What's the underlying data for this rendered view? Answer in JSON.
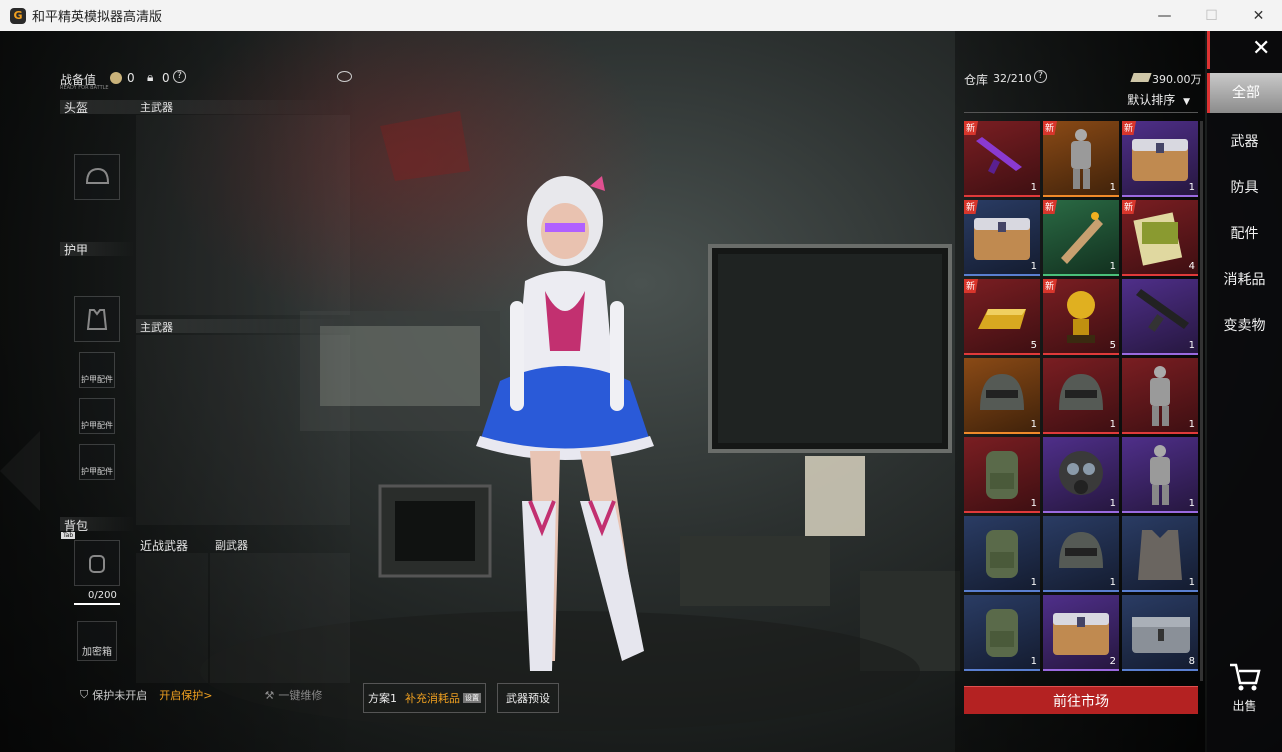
{
  "window": {
    "title": "和平精英模拟器高清版",
    "minimize": "—",
    "maximize": "☐",
    "close": "✕"
  },
  "left": {
    "combat_label": "战备值",
    "combat_value": "0",
    "lock_value": "0",
    "help": "?",
    "sub_label": "READY FOR BATTLE",
    "slots": {
      "helmet": "头盔",
      "primary1": "主武器",
      "armor": "护甲",
      "primary2": "主武器",
      "armor_attach": "护甲配件",
      "backpack": "背包",
      "melee": "近战武器",
      "secondary": "副武器",
      "bag_capacity": "0/200",
      "safe_box": "加密箱",
      "bag_key": "Tab"
    }
  },
  "bottom": {
    "protect_status": "保护未开启",
    "protect_action": "开启保护>",
    "repair": "一键维修",
    "plan": "方案1",
    "refill": "补充消耗品",
    "refill_tag": "设置",
    "preset": "武器预设"
  },
  "warehouse": {
    "label": "仓库",
    "count": "32/210",
    "help": "?",
    "money": "390.00万",
    "sort": "默认排序",
    "new_tag": "新",
    "market_button": "前往市场"
  },
  "items": [
    {
      "name": "紫色步枪",
      "rarity": "red",
      "qty": "1",
      "new": true,
      "icon": "rifle-icon"
    },
    {
      "name": "套装",
      "rarity": "orange",
      "qty": "1",
      "new": true,
      "icon": "suit-icon"
    },
    {
      "name": "补给箱",
      "rarity": "purple",
      "qty": "1",
      "new": true,
      "icon": "crate-icon"
    },
    {
      "name": "银色箱子",
      "rarity": "blue",
      "qty": "1",
      "new": true,
      "icon": "crate-icon"
    },
    {
      "name": "卷轴",
      "rarity": "green",
      "qty": "1",
      "new": true,
      "icon": "scroll-icon"
    },
    {
      "name": "书籍",
      "rarity": "red",
      "qty": "4",
      "new": true,
      "icon": "book-icon"
    },
    {
      "name": "金条",
      "rarity": "red",
      "qty": "5",
      "new": true,
      "icon": "gold-bar-icon"
    },
    {
      "name": "金色雕像",
      "rarity": "red",
      "qty": "5",
      "new": true,
      "icon": "trophy-icon"
    },
    {
      "name": "冲锋枪",
      "rarity": "purple",
      "qty": "1",
      "new": false,
      "icon": "smg-icon"
    },
    {
      "name": "头盔",
      "rarity": "orange",
      "qty": "1",
      "new": false,
      "icon": "helmet-icon"
    },
    {
      "name": "头盔",
      "rarity": "red",
      "qty": "1",
      "new": false,
      "icon": "helmet-icon"
    },
    {
      "name": "套装",
      "rarity": "red",
      "qty": "1",
      "new": false,
      "icon": "suit-icon"
    },
    {
      "name": "背包",
      "rarity": "red",
      "qty": "1",
      "new": false,
      "icon": "backpack-icon"
    },
    {
      "name": "防毒面具",
      "rarity": "purple",
      "qty": "1",
      "new": false,
      "icon": "gasmask-icon"
    },
    {
      "name": "套装",
      "rarity": "purple",
      "qty": "1",
      "new": false,
      "icon": "suit-icon"
    },
    {
      "name": "背包",
      "rarity": "blue",
      "qty": "1",
      "new": false,
      "icon": "backpack-icon"
    },
    {
      "name": "头盔",
      "rarity": "blue",
      "qty": "1",
      "new": false,
      "icon": "helmet-icon"
    },
    {
      "name": "防弹衣",
      "rarity": "blue",
      "qty": "1",
      "new": false,
      "icon": "vest-icon"
    },
    {
      "name": "背包",
      "rarity": "blue",
      "qty": "1",
      "new": false,
      "icon": "backpack-icon"
    },
    {
      "name": "补给箱",
      "rarity": "purple",
      "qty": "2",
      "new": false,
      "icon": "crate-icon"
    },
    {
      "name": "弹药箱",
      "rarity": "blue",
      "qty": "8",
      "new": false,
      "icon": "ammo-box-icon"
    }
  ],
  "categories": [
    "全部",
    "武器",
    "防具",
    "配件",
    "消耗品",
    "变卖物"
  ],
  "sell": {
    "label": "出售"
  },
  "colors": {
    "red": "#e03a3a",
    "orange": "#f08a2a",
    "purple": "#9a6ae0",
    "blue": "#5a7fd0",
    "green": "#4ac07a",
    "market": "#b42222"
  }
}
